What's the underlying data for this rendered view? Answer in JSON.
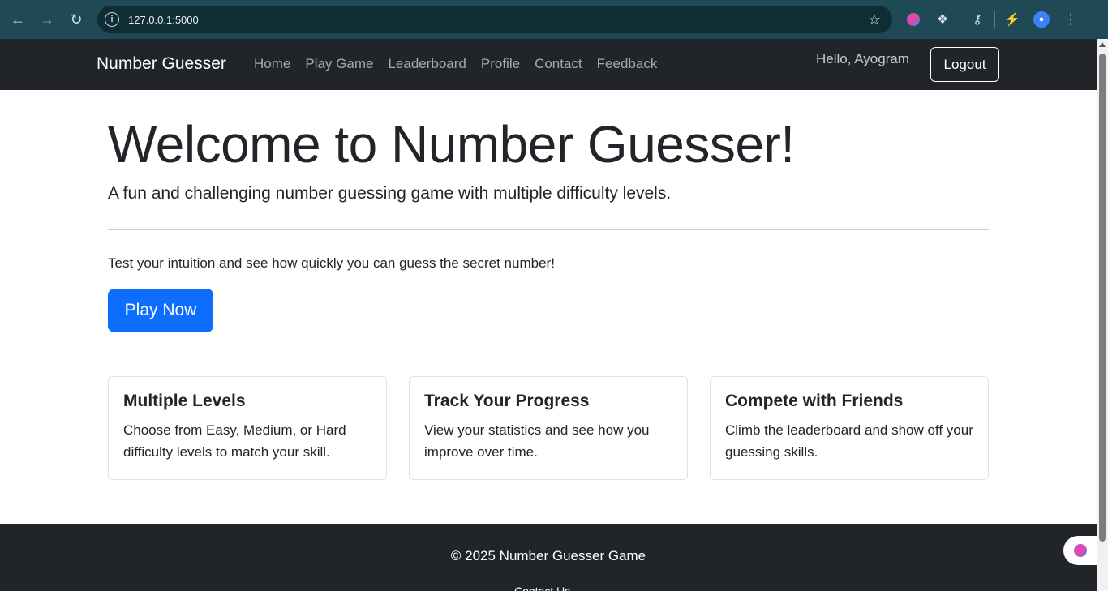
{
  "browser": {
    "url": "127.0.0.1:5000",
    "icons": [
      "back-icon",
      "forward-icon",
      "reload-icon",
      "site-info-icon",
      "bookmark-star-icon",
      "extension-brain-icon",
      "extensions-puzzle-icon",
      "password-key-icon",
      "performance-icon",
      "profile-avatar-icon",
      "menu-kebab-icon"
    ]
  },
  "navbar": {
    "brand": "Number Guesser",
    "links": [
      "Home",
      "Play Game",
      "Leaderboard",
      "Profile",
      "Contact",
      "Feedback"
    ],
    "greeting": "Hello, Ayogram",
    "logout_label": "Logout"
  },
  "hero": {
    "title": "Welcome to Number Guesser!",
    "lead": "A fun and challenging number guessing game with multiple difficulty levels.",
    "intro": "Test your intuition and see how quickly you can guess the secret number!",
    "cta_label": "Play Now"
  },
  "cards": [
    {
      "title": "Multiple Levels",
      "text": "Choose from Easy, Medium, or Hard difficulty levels to match your skill."
    },
    {
      "title": "Track Your Progress",
      "text": "View your statistics and see how you improve over time."
    },
    {
      "title": "Compete with Friends",
      "text": "Climb the leaderboard and show off your guessing skills."
    }
  ],
  "footer": {
    "copyright": "© 2025 Number Guesser Game",
    "partial_link": "Contact Us"
  },
  "colors": {
    "primary": "#0d6efd",
    "dark": "#212529",
    "chrome": "#1f4a55"
  }
}
